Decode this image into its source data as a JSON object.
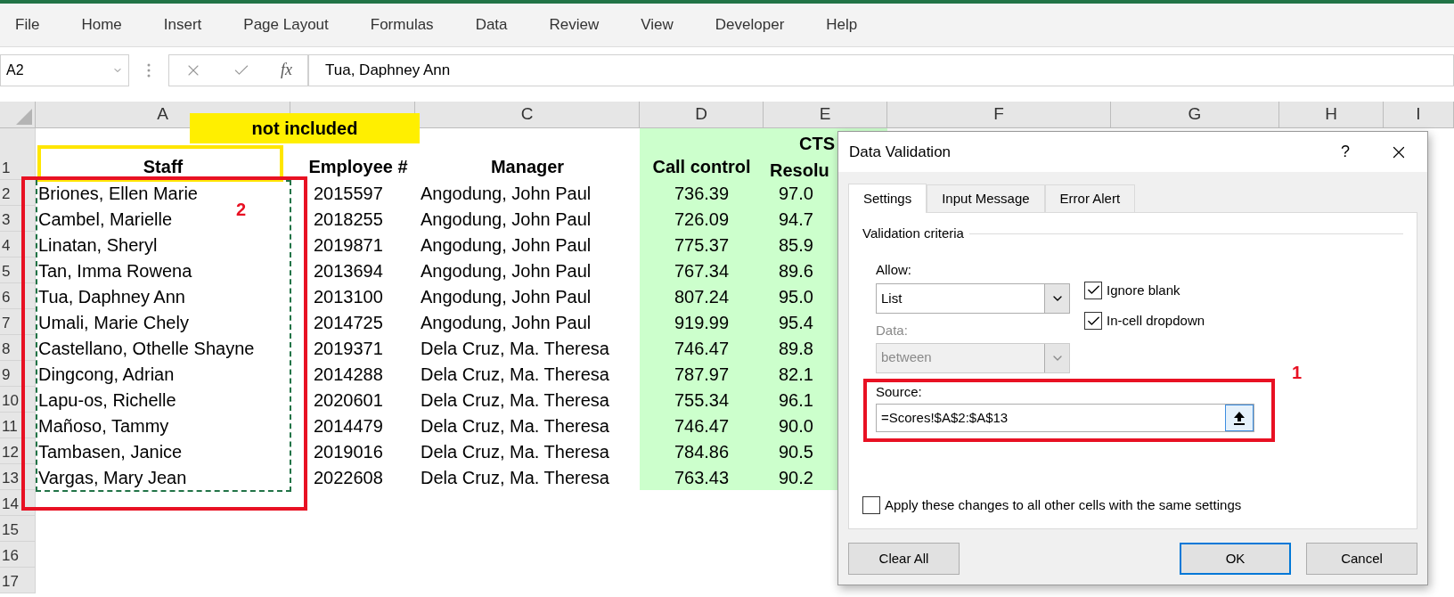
{
  "menu": [
    {
      "label": "File"
    },
    {
      "label": "Home"
    },
    {
      "label": "Insert"
    },
    {
      "label": "Page Layout"
    },
    {
      "label": "Formulas"
    },
    {
      "label": "Data"
    },
    {
      "label": "Review"
    },
    {
      "label": "View"
    },
    {
      "label": "Developer"
    },
    {
      "label": "Help"
    }
  ],
  "name_box": "A2",
  "fx": "fx",
  "formula": "Tua, Daphney Ann",
  "columns": [
    "A",
    "C",
    "D",
    "E",
    "F",
    "G",
    "H",
    "I"
  ],
  "row_numbers": [
    "1",
    "2",
    "3",
    "4",
    "5",
    "6",
    "7",
    "8",
    "9",
    "10",
    "11",
    "12",
    "13",
    "14",
    "15",
    "16",
    "17"
  ],
  "group_heading": "CTS",
  "headers": [
    "Staff",
    "Employee #",
    "Manager",
    "Call control",
    "Resolu"
  ],
  "rows": [
    [
      "Briones, Ellen Marie",
      "2015597",
      "Angodung, John Paul",
      "736.39",
      "97.0"
    ],
    [
      "Cambel, Marielle",
      "2018255",
      "Angodung, John Paul",
      "726.09",
      "94.7"
    ],
    [
      "Linatan, Sheryl",
      "2019871",
      "Angodung, John Paul",
      "775.37",
      "85.9"
    ],
    [
      "Tan, Imma Rowena",
      "2013694",
      "Angodung, John Paul",
      "767.34",
      "89.6"
    ],
    [
      "Tua, Daphney Ann",
      "2013100",
      "Angodung, John Paul",
      "807.24",
      "95.0"
    ],
    [
      "Umali, Marie Chely",
      "2014725",
      "Angodung, John Paul",
      "919.99",
      "95.4"
    ],
    [
      "Castellano, Othelle Shayne",
      "2019371",
      "Dela Cruz, Ma. Theresa",
      "746.47",
      "89.8"
    ],
    [
      "Dingcong, Adrian",
      "2014288",
      "Dela Cruz, Ma. Theresa",
      "787.97",
      "82.1"
    ],
    [
      "Lapu-os, Richelle",
      "2020601",
      "Dela Cruz, Ma. Theresa",
      "755.34",
      "96.1"
    ],
    [
      "Mañoso, Tammy",
      "2014479",
      "Dela Cruz, Ma. Theresa",
      "746.47",
      "90.0"
    ],
    [
      "Tambasen, Janice",
      "2019016",
      "Dela Cruz, Ma. Theresa",
      "784.86",
      "90.5"
    ],
    [
      "Vargas, Mary Jean",
      "2022608",
      "Dela Cruz, Ma. Theresa",
      "763.43",
      "90.2"
    ]
  ],
  "annotations": {
    "label": "not included",
    "marker_list": "2",
    "marker_source": "1"
  },
  "dialog": {
    "title": "Data Validation",
    "help": "?",
    "tabs": [
      {
        "label": "Settings",
        "selected": true
      },
      {
        "label": "Input Message",
        "selected": false
      },
      {
        "label": "Error Alert",
        "selected": false
      }
    ],
    "section": "Validation criteria",
    "allow": {
      "label": "Allow:",
      "value": "List",
      "disabled": false
    },
    "checkboxes": [
      {
        "label": "Ignore blank",
        "checked": true
      },
      {
        "label": "In-cell dropdown",
        "checked": true
      }
    ],
    "data": {
      "label": "Data:",
      "value": "between",
      "disabled": true
    },
    "source": {
      "label": "Source:",
      "value": "=Scores!$A$2:$A$13"
    },
    "apply": {
      "label": "Apply these changes to all other cells with the same settings",
      "checked": false
    },
    "buttons": [
      {
        "label": "Clear All",
        "default": false
      },
      {
        "label": "OK",
        "default": true
      },
      {
        "label": "Cancel",
        "default": false
      }
    ]
  }
}
